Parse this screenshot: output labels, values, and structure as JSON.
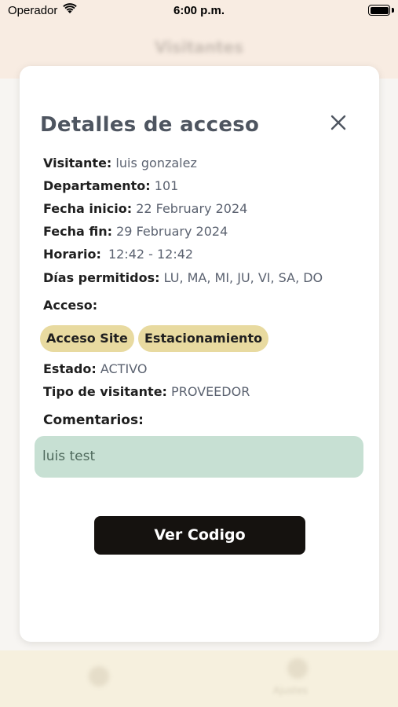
{
  "status_bar": {
    "carrier": "Operador",
    "time": "6:00 p.m."
  },
  "background": {
    "header_title": "Visitantes",
    "tabs": [
      {
        "icon": "home-icon"
      },
      {
        "icon": "profile-icon",
        "label": "Ajustes"
      }
    ]
  },
  "modal": {
    "title": "Detalles de acceso",
    "visitor_label": "Visitante:",
    "visitor_value": "luis gonzalez",
    "department_label": "Departamento:",
    "department_value": "101",
    "start_label": "Fecha inicio:",
    "start_value": "22 February 2024",
    "end_label": "Fecha fin:",
    "end_value": "29 February 2024",
    "schedule_label": "Horario:",
    "schedule_value": "12:42 - 12:42",
    "days_label": "Días permitidos:",
    "days_value": "LU, MA, MI, JU, VI, SA, DO",
    "access_label": "Acceso:",
    "access_chips": [
      "Acceso Site",
      "Estacionamiento"
    ],
    "status_label": "Estado:",
    "status_value": "ACTIVO",
    "visitor_type_label": "Tipo de visitante:",
    "visitor_type_value": "PROVEEDOR",
    "comments_label": "Comentarios:",
    "comments_value": "luis test",
    "view_code_button": "Ver Codigo"
  },
  "colors": {
    "chip_bg": "#e8daa0",
    "comment_bg": "#c7e0d3",
    "button_bg": "#15120f",
    "header_bg": "#f8ece2",
    "tabbar_bg": "#f6f0de"
  }
}
